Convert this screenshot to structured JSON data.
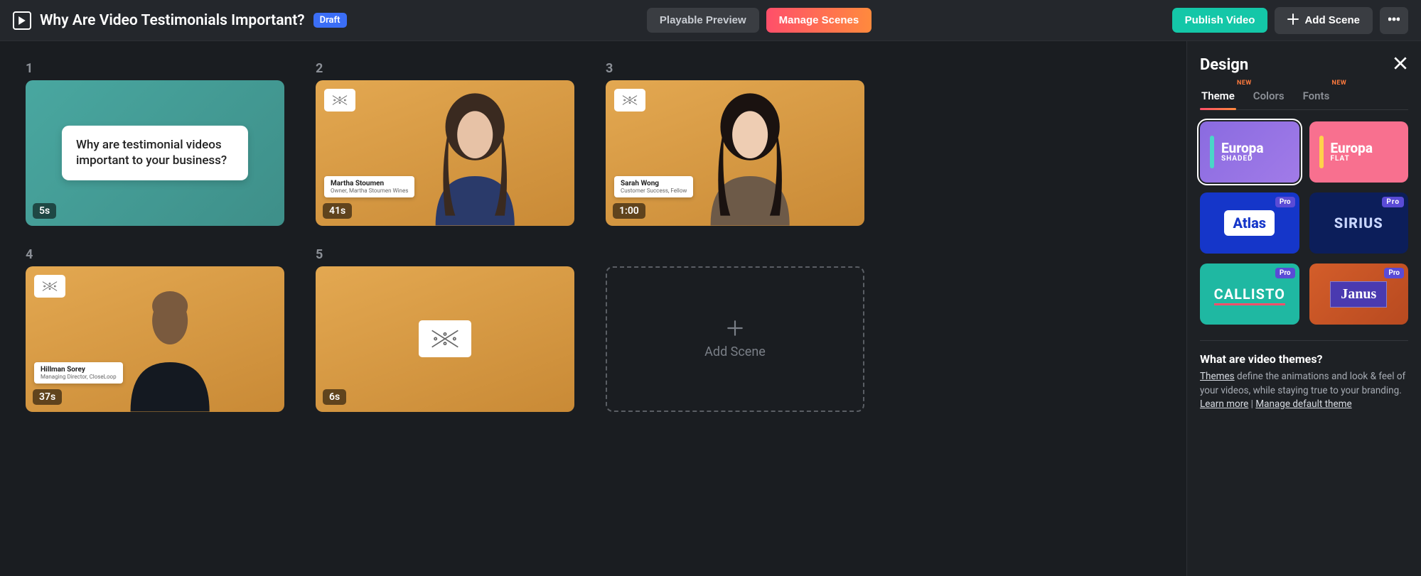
{
  "header": {
    "project_title": "Why Are Video Testimonials Important?",
    "status_badge": "Draft",
    "playable_preview": "Playable Preview",
    "manage_scenes": "Manage Scenes",
    "publish": "Publish Video",
    "add_scene": "Add Scene"
  },
  "scenes": [
    {
      "number": "1",
      "duration": "5s",
      "style": "teal",
      "kind": "text",
      "text": "Why are testimonial videos important to your business?"
    },
    {
      "number": "2",
      "duration": "41s",
      "style": "gold",
      "kind": "person",
      "person_variant": "p1",
      "lower_third": {
        "name": "Martha Stoumen",
        "role": "Owner, Martha Stoumen Wines"
      }
    },
    {
      "number": "3",
      "duration": "1:00",
      "style": "gold",
      "kind": "person",
      "person_variant": "p2",
      "lower_third": {
        "name": "Sarah Wong",
        "role": "Customer Success, Fellow"
      }
    },
    {
      "number": "4",
      "duration": "37s",
      "style": "gold",
      "kind": "person",
      "person_variant": "p3",
      "lower_third": {
        "name": "Hillman Sorey",
        "role": "Managing Director, CloseLoop"
      }
    },
    {
      "number": "5",
      "duration": "6s",
      "style": "gold",
      "kind": "logo"
    }
  ],
  "add_scene_card": "Add Scene",
  "sidebar": {
    "title": "Design",
    "tabs": [
      {
        "label": "Theme",
        "new": true,
        "active": true
      },
      {
        "label": "Colors",
        "new": false,
        "active": false
      },
      {
        "label": "Fonts",
        "new": true,
        "active": false
      }
    ],
    "themes": [
      {
        "name": "Europa",
        "sub": "SHADED",
        "preset": "t-europaS",
        "selected": true,
        "pro": false
      },
      {
        "name": "Europa",
        "sub": "FLAT",
        "preset": "t-europaF",
        "selected": false,
        "pro": false
      },
      {
        "name": "Atlas",
        "sub": "",
        "preset": "t-atlas",
        "selected": false,
        "pro": true
      },
      {
        "name": "SIRIUS",
        "sub": "",
        "preset": "t-sirius",
        "selected": false,
        "pro": true
      },
      {
        "name": "CALLISTO",
        "sub": "",
        "preset": "t-callisto",
        "selected": false,
        "pro": true
      },
      {
        "name": "Janus",
        "sub": "",
        "preset": "t-janus",
        "selected": false,
        "pro": true
      }
    ],
    "info": {
      "question": "What are video themes?",
      "themes_word": "Themes",
      "body_rest": " define the animations and look & feel of your videos, while staying true to your branding. ",
      "learn_more": "Learn more",
      "separator": " | ",
      "manage_default": "Manage default theme"
    },
    "pro_label": "Pro",
    "new_label": "NEW"
  }
}
